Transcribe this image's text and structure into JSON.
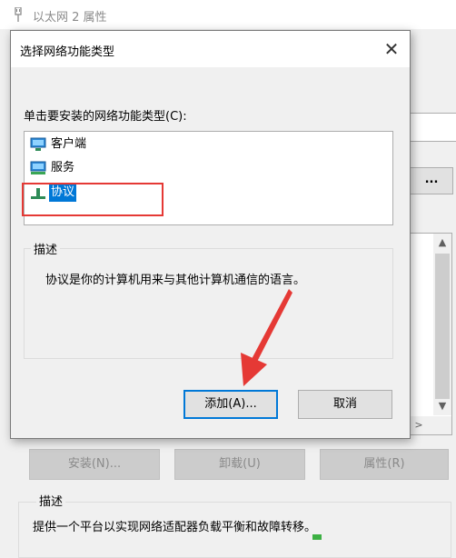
{
  "parent": {
    "title": "以太网 2 属性",
    "configure_label": "...",
    "buttons": {
      "install": "安装(N)...",
      "uninstall": "卸载(U)",
      "properties": "属性(R)"
    },
    "description_legend": "描述",
    "description_text": "提供一个平台以实现网络适配器负载平衡和故障转移。"
  },
  "dialog": {
    "title": "选择网络功能类型",
    "close_glyph": "✕",
    "prompt": "单击要安装的网络功能类型(C):",
    "types": [
      {
        "label": "客户端",
        "icon": "client-network-icon",
        "selected": false
      },
      {
        "label": "服务",
        "icon": "service-network-icon",
        "selected": false
      },
      {
        "label": "协议",
        "icon": "protocol-network-icon",
        "selected": true
      }
    ],
    "description_legend": "描述",
    "description_text": "协议是你的计算机用来与其他计算机通信的语言。",
    "add_button": "添加(A)...",
    "cancel_button": "取消"
  },
  "colors": {
    "selection": "#0078d7",
    "highlight_box": "#e53935",
    "arrow": "#e53935"
  }
}
